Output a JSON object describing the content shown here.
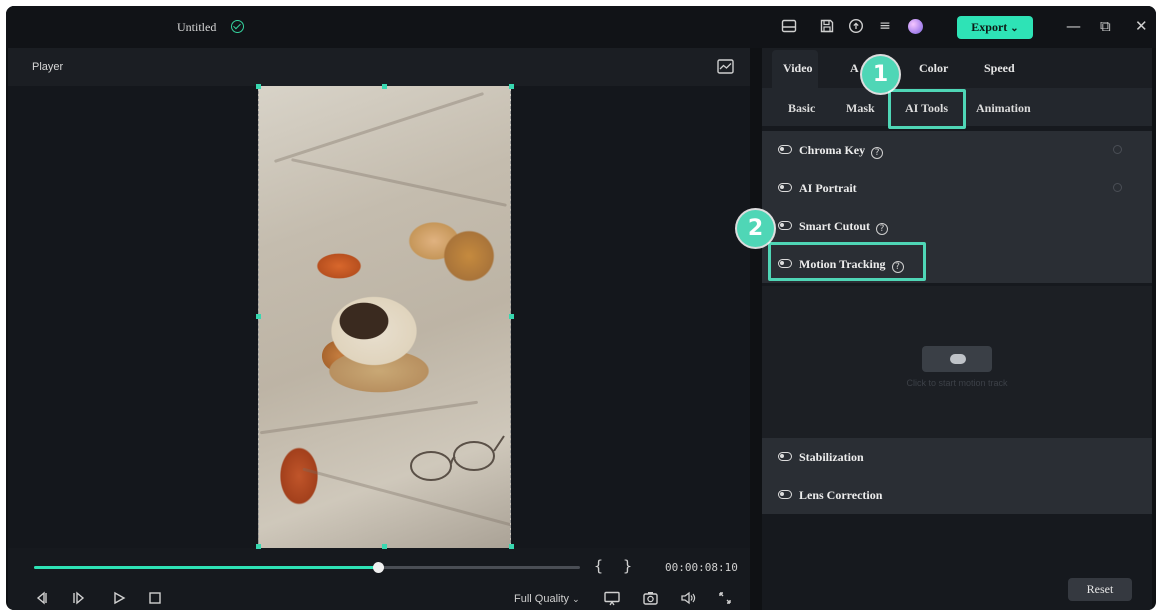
{
  "titlebar": {
    "doc_title": "Untitled",
    "export_label": "Export",
    "export_caret": "⌄",
    "minimize": "—",
    "maximize": "⧉",
    "close": "✕",
    "menu": "≡"
  },
  "player": {
    "title": "Player",
    "brace_open": "{",
    "brace_close": "}",
    "timecode": "00:00:08:10",
    "progress": 0.63,
    "quality_label": "Full Quality",
    "quality_caret": "⌄"
  },
  "panel": {
    "tabs": [
      {
        "label": "Video"
      },
      {
        "label": "A"
      },
      {
        "label": "Color"
      },
      {
        "label": "Speed"
      }
    ],
    "subtabs": [
      {
        "label": "Basic"
      },
      {
        "label": "Mask"
      },
      {
        "label": "AI Tools"
      },
      {
        "label": "Animation"
      }
    ],
    "rows": [
      {
        "label": "Chroma Key"
      },
      {
        "label": "AI Portrait"
      },
      {
        "label": "Smart Cutout"
      },
      {
        "label": "Motion Tracking"
      },
      {
        "label": "Stabilization"
      },
      {
        "label": "Lens Correction"
      }
    ],
    "help_glyph": "?",
    "motion_hint": "Click to start motion track",
    "reset_label": "Reset"
  },
  "badges": [
    "1",
    "2"
  ],
  "colors": {
    "accent": "#2ee3b6",
    "highlight": "#4fd6b6",
    "background": "#0f1114"
  }
}
